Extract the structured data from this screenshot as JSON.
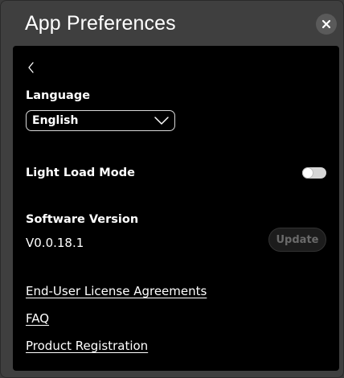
{
  "window": {
    "title": "App Preferences"
  },
  "close_icon": "close-icon",
  "back_icon": "chevron-left-icon",
  "language": {
    "label": "Language",
    "selected": "English"
  },
  "light_load": {
    "label": "Light Load Mode",
    "enabled": false
  },
  "software": {
    "label": "Software Version",
    "version": "V0.0.18.1",
    "update_label": "Update",
    "update_enabled": false
  },
  "links": {
    "eula": "End-User License Agreements",
    "faq": "FAQ",
    "registration": "Product Registration"
  },
  "colors": {
    "window_bg": "#3f3f3f",
    "panel_bg": "#000000",
    "text": "#ffffff",
    "disabled_text": "#6a6a6a"
  }
}
